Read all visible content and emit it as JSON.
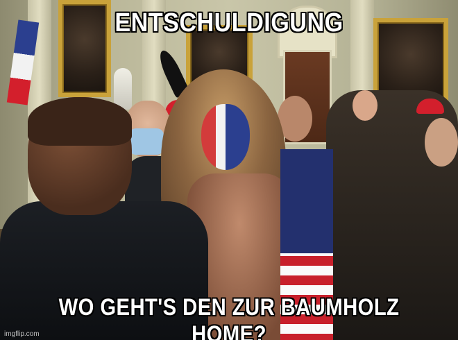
{
  "meme": {
    "top_text": "ENTSCHULDIGUNG",
    "bottom_text": "WO GEHT'S DEN ZUR BAUMHOLZ HOME?",
    "watermark": "imgflip.com"
  },
  "colors": {
    "caption_fill": "#ffffff",
    "caption_outline": "#000000",
    "flag_blue": "#23306e",
    "flag_red": "#c8202b"
  }
}
